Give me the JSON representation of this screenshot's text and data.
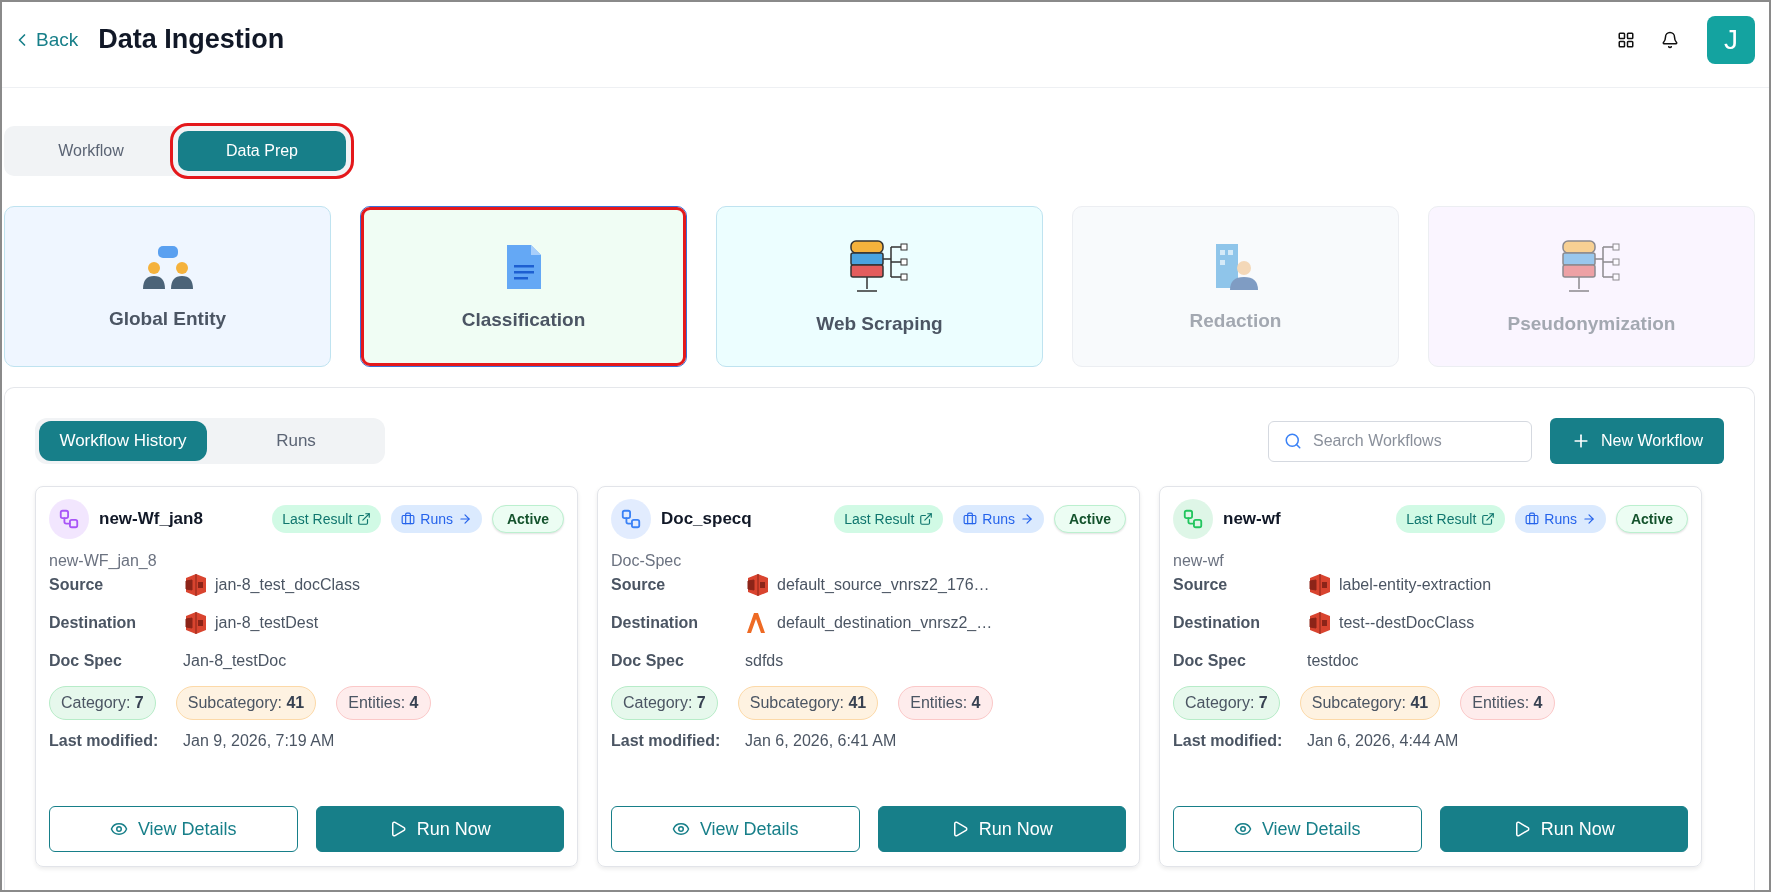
{
  "header": {
    "back": "Back",
    "title": "Data Ingestion",
    "avatar": "J"
  },
  "top_tabs": [
    {
      "label": "Workflow",
      "selected": false,
      "highlighted": false
    },
    {
      "label": "Data Prep",
      "selected": true,
      "highlighted": true
    }
  ],
  "modules": [
    {
      "label": "Global Entity",
      "kind": "people",
      "color": "#eff6ff",
      "selected": false,
      "disabled": false,
      "highlighted": false
    },
    {
      "label": "Classification",
      "kind": "document",
      "color": "#f0fdf4",
      "selected": true,
      "disabled": false,
      "highlighted": true
    },
    {
      "label": "Web Scraping",
      "kind": "server",
      "color": "#ecfeff",
      "selected": false,
      "disabled": false,
      "highlighted": false
    },
    {
      "label": "Redaction",
      "kind": "building",
      "color": "#f8fafc",
      "selected": false,
      "disabled": true,
      "highlighted": false
    },
    {
      "label": "Pseudonymization",
      "kind": "database",
      "color": "#faf5ff",
      "selected": false,
      "disabled": true,
      "highlighted": false
    }
  ],
  "panel": {
    "tabs": [
      {
        "label": "Workflow History",
        "selected": true
      },
      {
        "label": "Runs",
        "selected": false
      }
    ],
    "search": {
      "placeholder": "Search Workflows"
    },
    "new_button": "New Workflow"
  },
  "workflows": [
    {
      "name": "new-Wf_jan8",
      "color": "#a855f7",
      "description": "new-WF_jan_8",
      "last_result": "Last Result",
      "runs": "Runs",
      "status": "Active",
      "fields": [
        {
          "label": "Source",
          "value": "jan-8_test_docClass",
          "kind": "bucket"
        },
        {
          "label": "Destination",
          "value": "jan-8_testDest",
          "kind": "bucket"
        },
        {
          "label": "Doc Spec",
          "value": "Jan-8_testDoc",
          "kind": "text"
        }
      ],
      "counts": [
        {
          "text": "Category: **7**",
          "color": "#b7ecc8"
        },
        {
          "text": "Subcategory: **41**",
          "color": "#fcd9a8"
        },
        {
          "text": "Entities: **4**",
          "color": "#fbc8c8"
        }
      ],
      "modified_label": "Last modified:",
      "modified": "Jan 9, 2026, 7:19 AM",
      "view": "View Details",
      "run": "Run Now"
    },
    {
      "name": "Doc_specq",
      "color": "#3b82f6",
      "description": "Doc-Spec",
      "last_result": "Last Result",
      "runs": "Runs",
      "status": "Active",
      "fields": [
        {
          "label": "Source",
          "value": "default_source_vnrsz2_176…",
          "kind": "bucket"
        },
        {
          "label": "Destination",
          "value": "default_destination_vnrsz2_…",
          "kind": "chevron"
        },
        {
          "label": "Doc Spec",
          "value": "sdfds",
          "kind": "text"
        }
      ],
      "counts": [
        {
          "text": "Category: **7**",
          "color": "#b7ecc8"
        },
        {
          "text": "Subcategory: **41**",
          "color": "#fcd9a8"
        },
        {
          "text": "Entities: **4**",
          "color": "#fbc8c8"
        }
      ],
      "modified_label": "Last modified:",
      "modified": "Jan 6, 2026, 6:41 AM",
      "view": "View Details",
      "run": "Run Now"
    },
    {
      "name": "new-wf",
      "color": "#22c55e",
      "description": "new-wf",
      "last_result": "Last Result",
      "runs": "Runs",
      "status": "Active",
      "fields": [
        {
          "label": "Source",
          "value": "label-entity-extraction",
          "kind": "bucket"
        },
        {
          "label": "Destination",
          "value": "test--destDocClass",
          "kind": "bucket"
        },
        {
          "label": "Doc Spec",
          "value": "testdoc",
          "kind": "text"
        }
      ],
      "counts": [
        {
          "text": "Category: **7**",
          "color": "#b7ecc8"
        },
        {
          "text": "Subcategory: **41**",
          "color": "#fcd9a8"
        },
        {
          "text": "Entities: **4**",
          "color": "#fbc8c8"
        }
      ],
      "modified_label": "Last modified:",
      "modified": "Jan 6, 2026, 4:44 AM",
      "view": "View Details",
      "run": "Run Now"
    }
  ]
}
